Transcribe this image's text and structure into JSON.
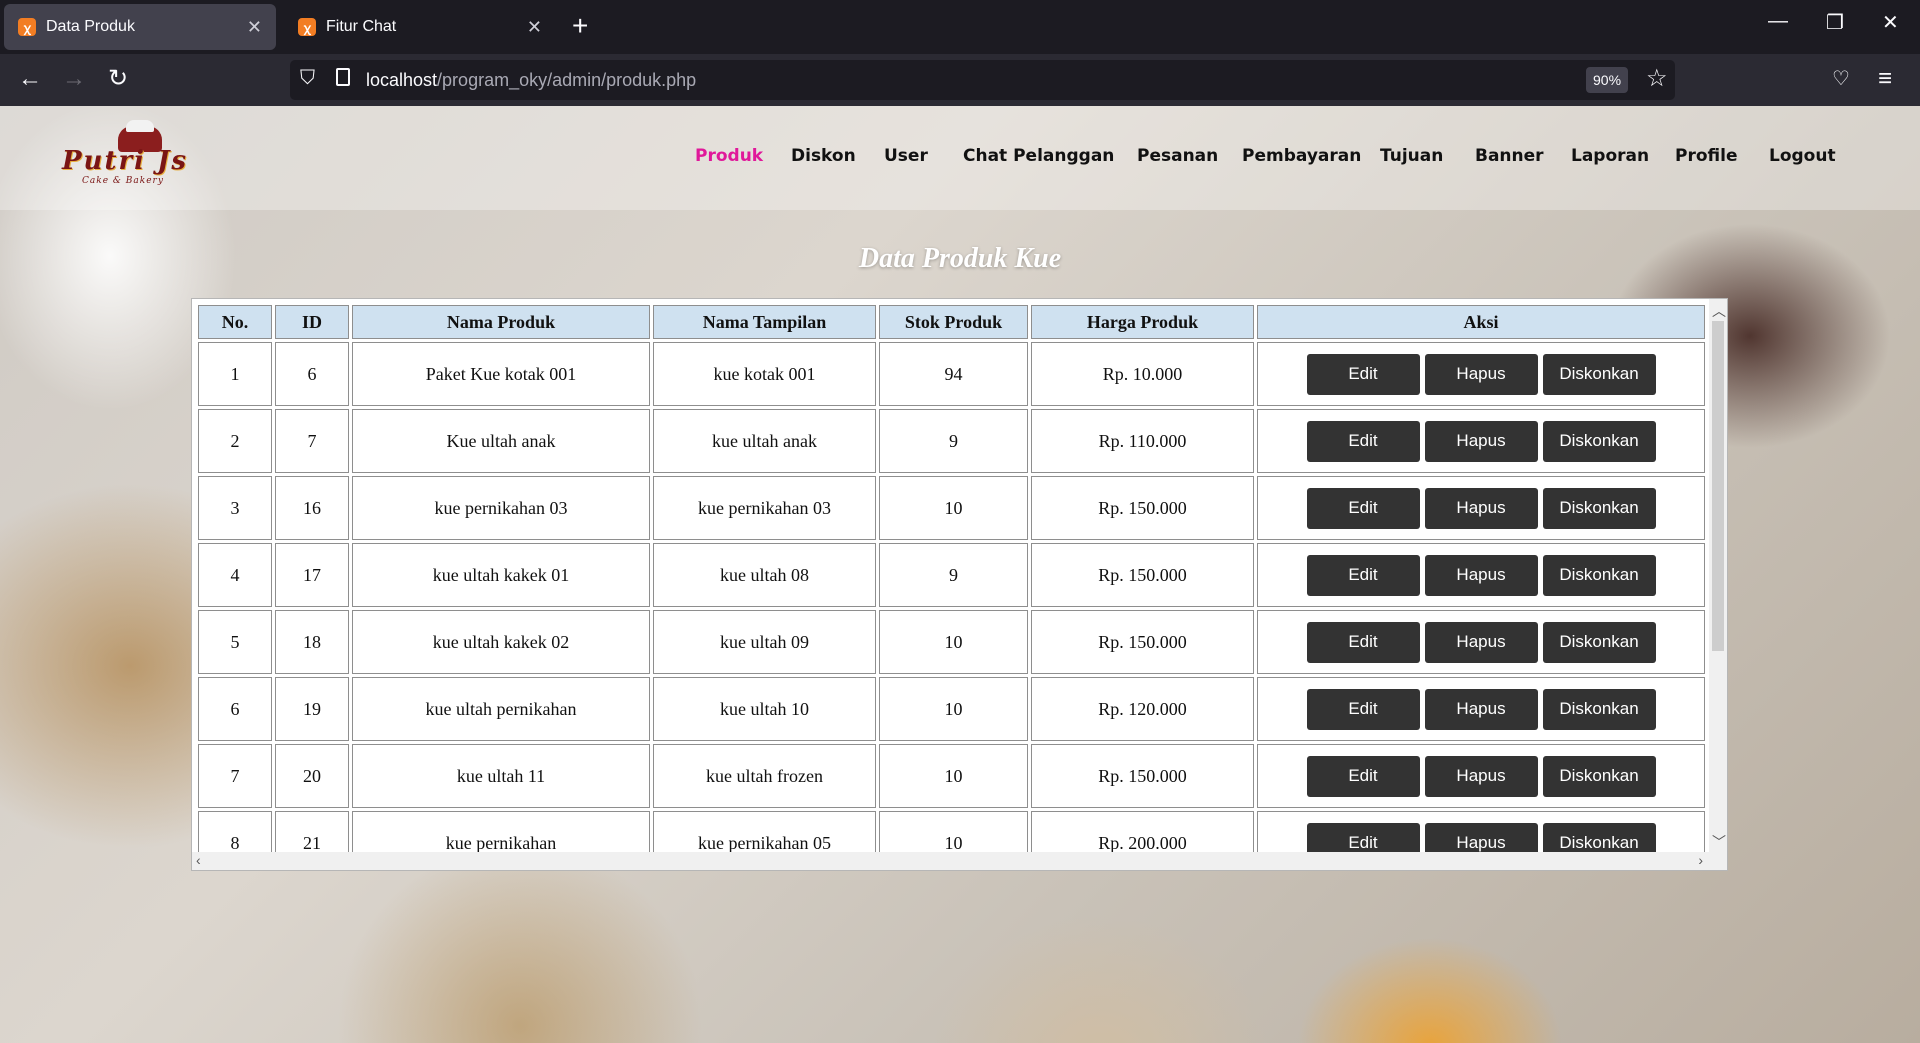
{
  "browser": {
    "tabs": [
      {
        "label": "Data Produk",
        "favicon": "xampp-icon",
        "active": true
      },
      {
        "label": "Fitur Chat",
        "favicon": "xampp-icon",
        "active": false
      }
    ],
    "url_host": "localhost",
    "url_path": "/program_oky/admin/produk.php",
    "zoom": "90%"
  },
  "site": {
    "logo_text": "Putri Js",
    "logo_tagline": "Cake & Bakery",
    "menu": [
      "Produk",
      "Diskon",
      "User",
      "Chat Pelanggan",
      "Pesanan",
      "Pembayaran",
      "Tujuan",
      "Banner",
      "Laporan",
      "Profile",
      "Logout"
    ],
    "active_menu": "Produk",
    "active_color": "#e0189a"
  },
  "main": {
    "title": "Data Produk Kue",
    "table": {
      "headers": [
        "No.",
        "ID",
        "Nama Produk",
        "Nama Tampilan",
        "Stok Produk",
        "Harga Produk",
        "Aksi"
      ],
      "rows": [
        {
          "no": "1",
          "id": "6",
          "nama": "Paket Kue kotak 001",
          "tampilan": "kue kotak 001",
          "stok": "94",
          "harga": "Rp. 10.000"
        },
        {
          "no": "2",
          "id": "7",
          "nama": "Kue ultah anak",
          "tampilan": "kue ultah anak",
          "stok": "9",
          "harga": "Rp. 110.000"
        },
        {
          "no": "3",
          "id": "16",
          "nama": "kue pernikahan 03",
          "tampilan": "kue pernikahan 03",
          "stok": "10",
          "harga": "Rp. 150.000"
        },
        {
          "no": "4",
          "id": "17",
          "nama": "kue ultah kakek 01",
          "tampilan": "kue ultah 08",
          "stok": "9",
          "harga": "Rp. 150.000"
        },
        {
          "no": "5",
          "id": "18",
          "nama": "kue ultah kakek 02",
          "tampilan": "kue ultah 09",
          "stok": "10",
          "harga": "Rp. 150.000"
        },
        {
          "no": "6",
          "id": "19",
          "nama": "kue ultah pernikahan",
          "tampilan": "kue ultah 10",
          "stok": "10",
          "harga": "Rp. 120.000"
        },
        {
          "no": "7",
          "id": "20",
          "nama": "kue ultah 11",
          "tampilan": "kue ultah frozen",
          "stok": "10",
          "harga": "Rp. 150.000"
        },
        {
          "no": "8",
          "id": "21",
          "nama": "kue pernikahan",
          "tampilan": "kue pernikahan 05",
          "stok": "10",
          "harga": "Rp. 200.000"
        }
      ],
      "actions": {
        "edit": "Edit",
        "hapus": "Hapus",
        "diskon": "Diskonkan"
      }
    }
  }
}
